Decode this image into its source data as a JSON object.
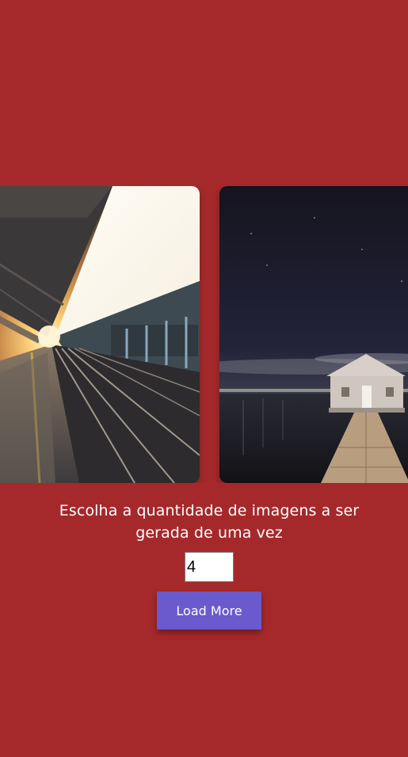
{
  "gallery": {
    "images": [
      {
        "name": "train-station-sunset"
      },
      {
        "name": "boathouse-night-pier"
      }
    ]
  },
  "controls": {
    "prompt_text": "Escolha a quantidade de imagens a ser gerada de uma vez",
    "quantity_value": "4",
    "load_button_label": "Load More"
  },
  "colors": {
    "background": "#a5292a",
    "button": "#6a5acd",
    "text": "#ffffff"
  }
}
